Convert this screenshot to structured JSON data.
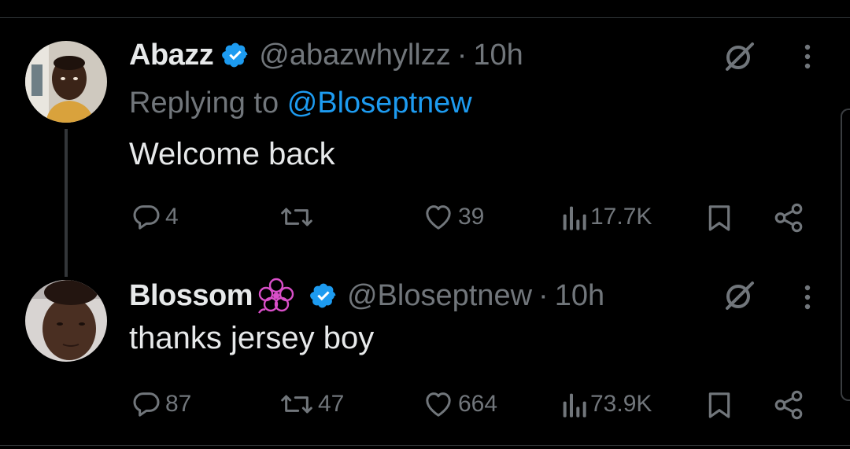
{
  "tweets": [
    {
      "display_name": "Abazz",
      "handle": "@abazwhyllzz",
      "separator": "·",
      "time": "10h",
      "replying_prefix": "Replying to",
      "replying_to": "@Bloseptnew",
      "text": "Welcome back",
      "replies": "4",
      "reposts": "",
      "likes": "39",
      "views": "17.7K"
    },
    {
      "display_name": "Blossom",
      "handle": "@Bloseptnew",
      "separator": "·",
      "time": "10h",
      "text": "thanks jersey boy",
      "replies": "87",
      "reposts": "47",
      "likes": "664",
      "views": "73.9K"
    }
  ],
  "colors": {
    "background": "#000000",
    "text_primary": "#e7e9ea",
    "text_secondary": "#71767b",
    "accent": "#1d9bf0",
    "flower_emoji": "#d94fc9"
  },
  "icons": [
    "verified-badge-icon",
    "grok-icon",
    "more-icon",
    "reply-icon",
    "repost-icon",
    "like-icon",
    "views-icon",
    "bookmark-icon",
    "share-icon",
    "flower-emoji-icon"
  ]
}
